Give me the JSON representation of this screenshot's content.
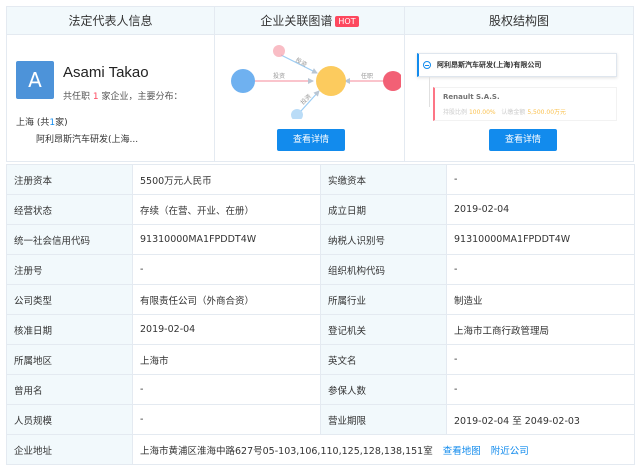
{
  "headers": {
    "legal_rep": "法定代表人信息",
    "relation_graph": "企业关联图谱",
    "hot_badge": "HOT",
    "equity": "股权结构图"
  },
  "legal_rep": {
    "avatar_letter": "A",
    "name": "Asami Takao",
    "sub_prefix": "共任职",
    "sub_count": "1",
    "sub_suffix": "家企业，主要分布：",
    "location": "上海",
    "location_paren_open": "(共",
    "location_count": "1",
    "location_paren_close": "家)",
    "company": "阿利昂斯汽车研发(上海..."
  },
  "graph": {
    "labels": [
      "投资",
      "任职",
      "投资",
      "投资"
    ],
    "button": "查看详情"
  },
  "equity": {
    "company": "阿利昂斯汽车研发(上海)有限公司",
    "shareholder": "Renault S.A.S.",
    "ratio_label": "持股比例",
    "ratio_value": "100.00%",
    "amount_label": "认缴金额",
    "amount_value": "5,500.00万元",
    "button": "查看详情"
  },
  "rows": [
    {
      "k1": "注册资本",
      "v1": "5500万元人民币",
      "k2": "实缴资本",
      "v2": "-"
    },
    {
      "k1": "经营状态",
      "v1": "存续（在营、开业、在册）",
      "k2": "成立日期",
      "v2": "2019-02-04"
    },
    {
      "k1": "统一社会信用代码",
      "v1": "91310000MA1FPDDT4W",
      "k2": "纳税人识别号",
      "v2": "91310000MA1FPDDT4W"
    },
    {
      "k1": "注册号",
      "v1": "-",
      "k2": "组织机构代码",
      "v2": "-"
    },
    {
      "k1": "公司类型",
      "v1": "有限责任公司（外商合资）",
      "k2": "所属行业",
      "v2": "制造业"
    },
    {
      "k1": "核准日期",
      "v1": "2019-02-04",
      "k2": "登记机关",
      "v2": "上海市工商行政管理局"
    },
    {
      "k1": "所属地区",
      "v1": "上海市",
      "k2": "英文名",
      "v2": "-"
    },
    {
      "k1": "曾用名",
      "v1": "-",
      "k2": "参保人数",
      "v2": "-"
    },
    {
      "k1": "人员规模",
      "v1": "-",
      "k2": "营业期限",
      "v2": "2019-02-04 至 2049-02-03"
    }
  ],
  "address": {
    "label": "企业地址",
    "value": "上海市黄浦区淮海中路627号05-103,106,110,125,128,138,151室",
    "map_link": "查看地图",
    "nearby_link": "附近公司"
  },
  "colors": {
    "accent_blue": "#128bed",
    "hot_red": "#fd485e",
    "header_bg": "#f2f9fc",
    "node_blue": "#6fb1f0",
    "node_orange": "#fccb5e",
    "node_red": "#f26075"
  }
}
